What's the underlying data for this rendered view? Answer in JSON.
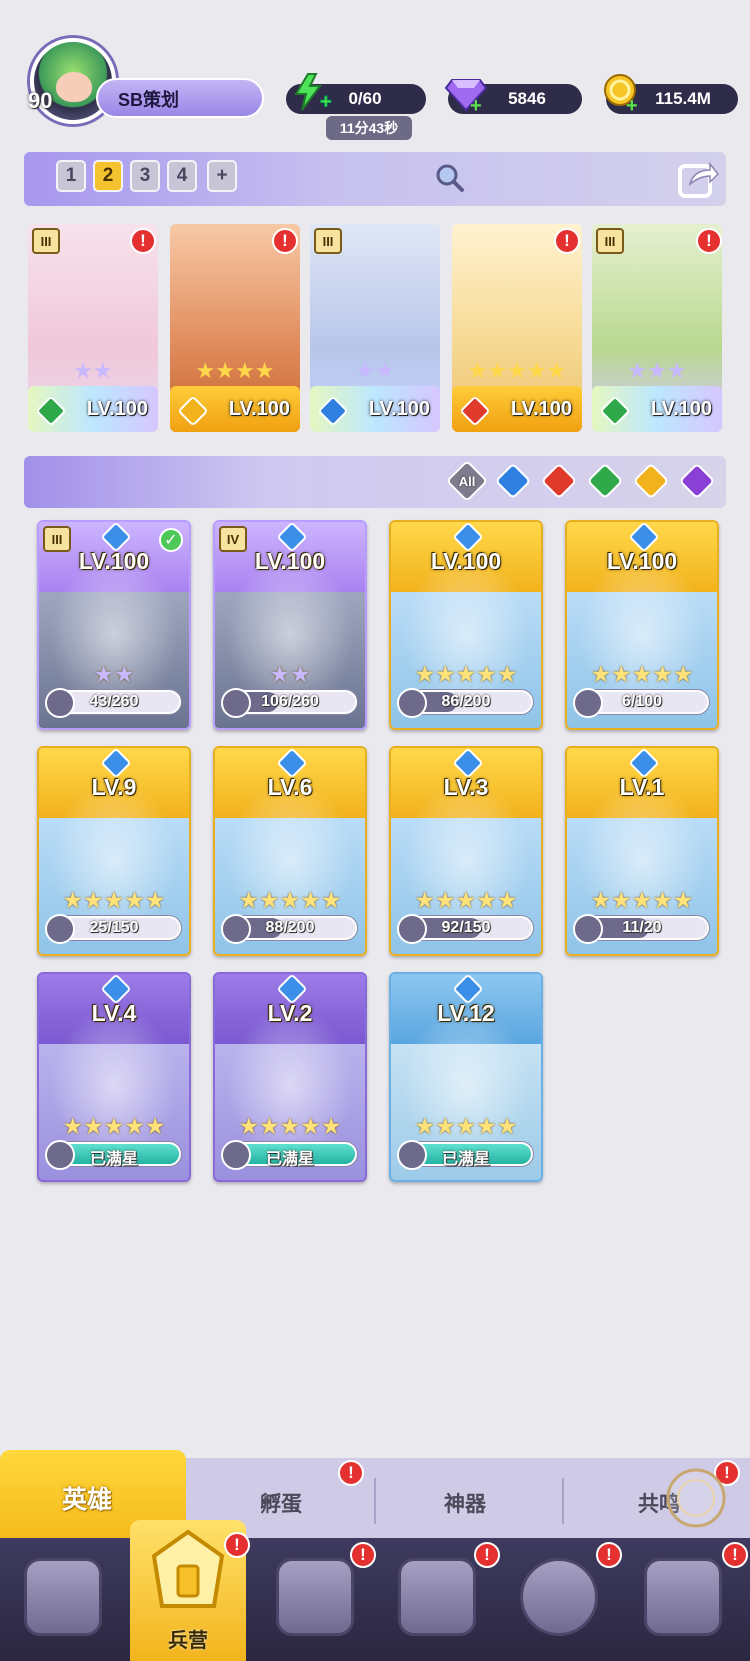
{
  "player": {
    "level": "90",
    "name": "SB策划"
  },
  "resources": {
    "energy": {
      "value": "0/60",
      "timer": "11分43秒",
      "icon": "lightning-icon"
    },
    "gems": {
      "value": "5846",
      "icon": "diamond-icon"
    },
    "gold": {
      "value": "115.4M",
      "icon": "coin-icon"
    }
  },
  "team": {
    "tabs": [
      "1",
      "2",
      "3",
      "4",
      "+"
    ],
    "active_tab": "2",
    "slots": [
      {
        "level": "LV.100",
        "stars": 2,
        "element": "grass",
        "rank": "III",
        "alert": "!"
      },
      {
        "level": "LV.100",
        "stars": 4,
        "element": "light",
        "rank": "",
        "alert": "!"
      },
      {
        "level": "LV.100",
        "stars": 2,
        "element": "water",
        "rank": "III",
        "alert": ""
      },
      {
        "level": "LV.100",
        "stars": 5,
        "element": "fire",
        "rank": "",
        "alert": "!"
      },
      {
        "level": "LV.100",
        "stars": 3,
        "element": "grass",
        "rank": "III",
        "alert": "!"
      }
    ]
  },
  "filters": {
    "all_label": "All",
    "elements": [
      "water",
      "fire",
      "grass",
      "light",
      "dark"
    ]
  },
  "heroes": [
    {
      "level": "LV.100",
      "progress": "43/260",
      "stars": 2,
      "rank": "III",
      "checked": true,
      "frame": "purple"
    },
    {
      "level": "LV.100",
      "progress": "106/260",
      "stars": 2,
      "rank": "IV",
      "checked": false,
      "frame": "purple"
    },
    {
      "level": "LV.100",
      "progress": "86/200",
      "stars": 5,
      "rank": "",
      "checked": false,
      "frame": "gold"
    },
    {
      "level": "LV.100",
      "progress": "6/100",
      "stars": 5,
      "rank": "",
      "checked": false,
      "frame": "gold"
    },
    {
      "level": "LV.9",
      "progress": "25/150",
      "stars": 5,
      "rank": "",
      "checked": false,
      "frame": "gold"
    },
    {
      "level": "LV.6",
      "progress": "88/200",
      "stars": 5,
      "rank": "",
      "checked": false,
      "frame": "gold"
    },
    {
      "level": "LV.3",
      "progress": "92/150",
      "stars": 5,
      "rank": "",
      "checked": false,
      "frame": "gold"
    },
    {
      "level": "LV.1",
      "progress": "11/20",
      "stars": 5,
      "rank": "",
      "checked": false,
      "frame": "gold"
    },
    {
      "level": "LV.4",
      "progress": "已满星",
      "stars": 5,
      "rank": "",
      "checked": false,
      "frame": "violet"
    },
    {
      "level": "LV.2",
      "progress": "已满星",
      "stars": 5,
      "rank": "",
      "checked": false,
      "frame": "violet"
    },
    {
      "level": "LV.12",
      "progress": "已满星",
      "stars": 5,
      "rank": "",
      "checked": false,
      "frame": "blue"
    }
  ],
  "subtabs": [
    "英雄",
    "孵蛋",
    "神器",
    "共鸣"
  ],
  "nav": {
    "selected_label": "兵营"
  },
  "alert_glyph": "!",
  "colors": {
    "water": "#2f7fe0",
    "fire": "#e03a2a",
    "grass": "#2fa84a",
    "light": "#f2b21c",
    "dark": "#8a3fd6"
  }
}
